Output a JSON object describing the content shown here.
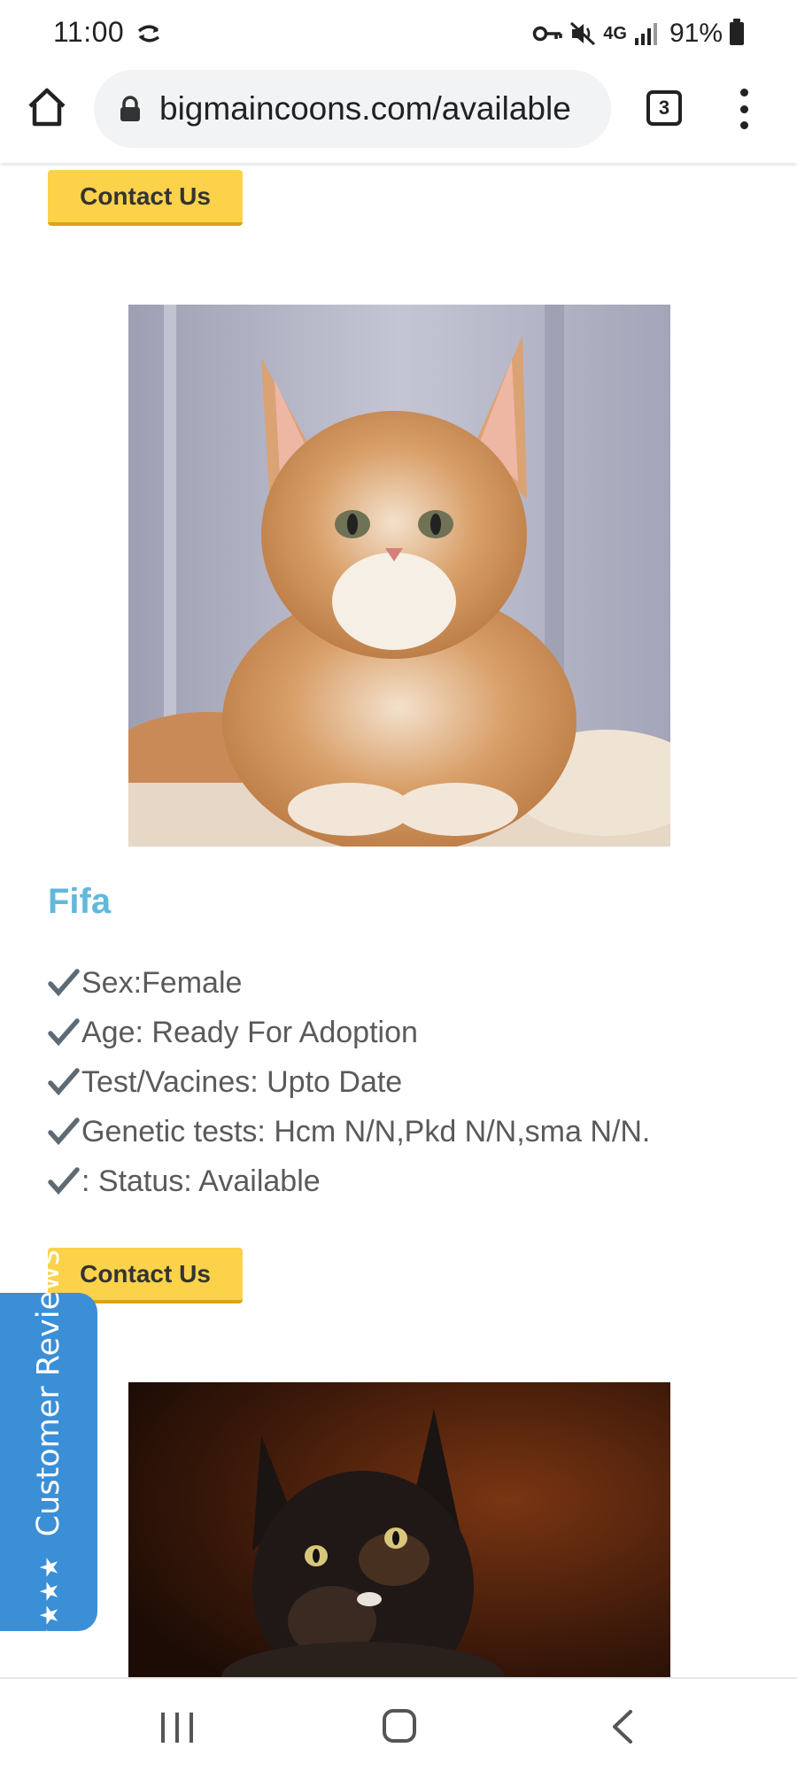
{
  "status_bar": {
    "time": "11:00",
    "network": "4G",
    "battery_percent": "91%"
  },
  "browser": {
    "url": "bigmaincoons.com/available",
    "tab_count": "3"
  },
  "page": {
    "contact_button_label": "Contact Us",
    "kitten": {
      "name": "Fifa",
      "features": [
        "Sex:Female",
        "Age: Ready For Adoption",
        "Test/Vacines: Upto Date",
        "Genetic tests: Hcm N/N,Pkd N/N,sma N/N.",
        ": Status: Available"
      ]
    },
    "reviews_tab": {
      "stars": "★★★★★",
      "label": "Customer Reviews",
      "color": "#3b8fd6"
    },
    "accent_colors": {
      "button": "#fbd249",
      "name": "#62b8dc"
    }
  }
}
